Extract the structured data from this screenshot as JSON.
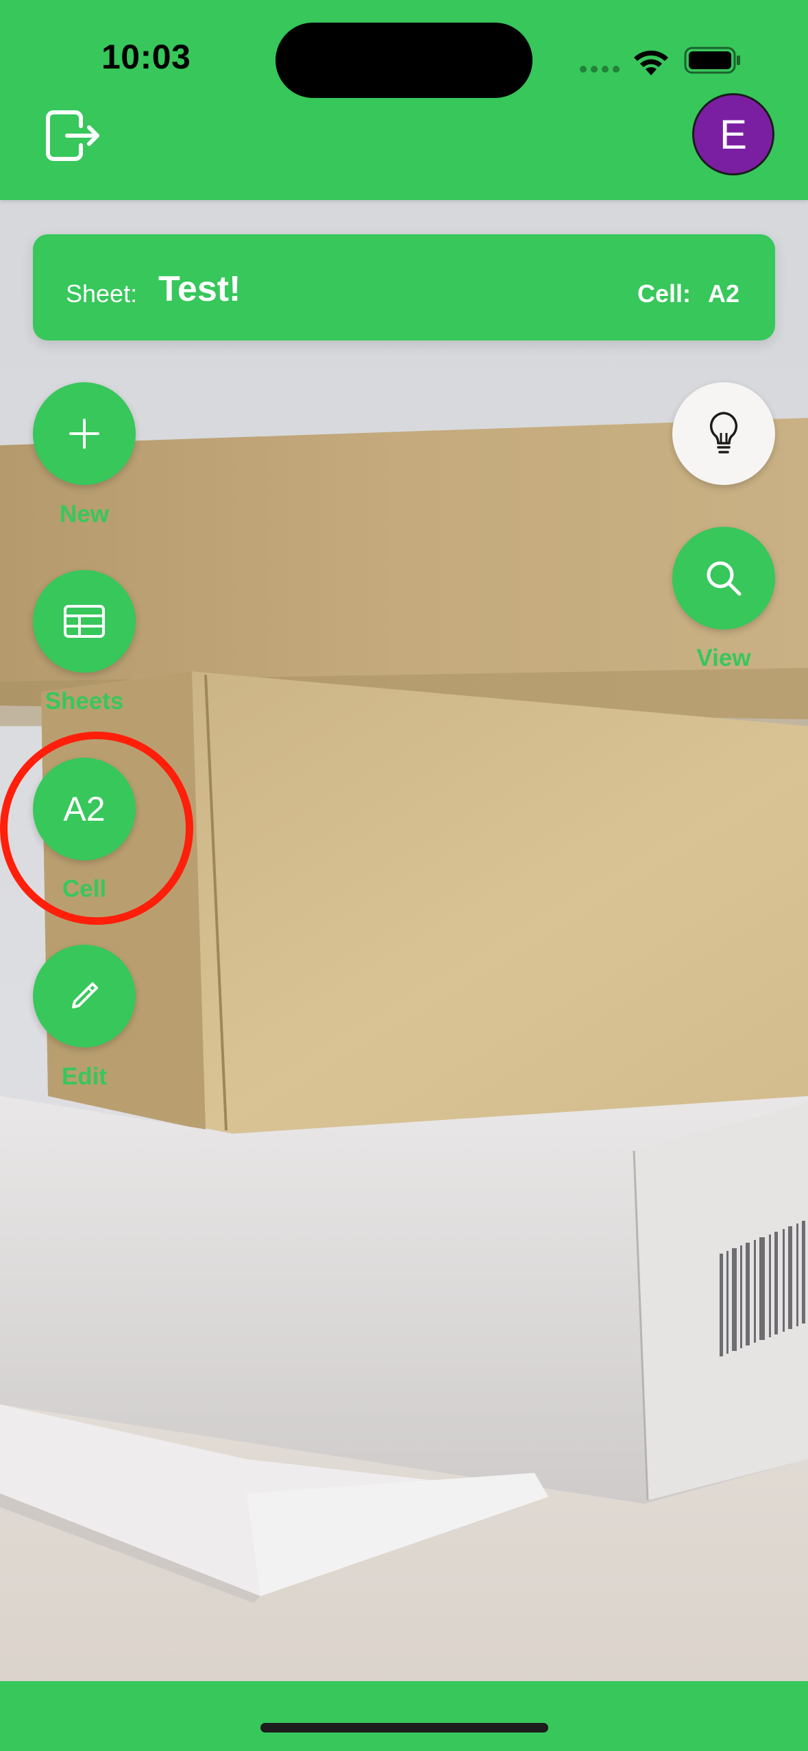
{
  "status_bar": {
    "time": "10:03"
  },
  "header": {
    "avatar_initial": "E",
    "logout_icon": "logout-icon"
  },
  "info_bar": {
    "sheet_label": "Sheet:",
    "sheet_name": "Test!",
    "cell_label": "Cell:",
    "cell_value": "A2"
  },
  "left_actions": [
    {
      "label": "New",
      "icon": "plus-icon"
    },
    {
      "label": "Sheets",
      "icon": "table-icon"
    },
    {
      "label": "Cell",
      "icon_text": "A2"
    },
    {
      "label": "Edit",
      "icon": "pencil-icon"
    }
  ],
  "right_actions": [
    {
      "label": "",
      "icon": "lightbulb-icon"
    },
    {
      "label": "View",
      "icon": "search-icon"
    }
  ],
  "colors": {
    "accent_green": "#37c75b",
    "avatar_purple": "#7b1fa2",
    "highlight_red": "#ff1f0a"
  }
}
